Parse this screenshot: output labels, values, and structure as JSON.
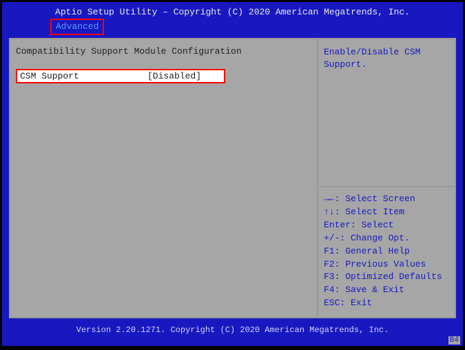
{
  "header": {
    "title": "Aptio Setup Utility – Copyright (C) 2020 American Megatrends, Inc.",
    "active_tab": "Advanced"
  },
  "main": {
    "section_title": "Compatibility Support Module Configuration",
    "setting": {
      "label": "CSM Support",
      "value": "[Disabled]"
    }
  },
  "help": {
    "description": "Enable/Disable CSM Support.",
    "keys": [
      "→←: Select Screen",
      "↑↓: Select Item",
      "Enter: Select",
      "+/-: Change Opt.",
      "F1: General Help",
      "F2: Previous Values",
      "F3: Optimized Defaults",
      "F4: Save & Exit",
      "ESC: Exit"
    ]
  },
  "footer": {
    "version": "Version 2.20.1271. Copyright (C) 2020 American Megatrends, Inc."
  },
  "badge": "B4"
}
